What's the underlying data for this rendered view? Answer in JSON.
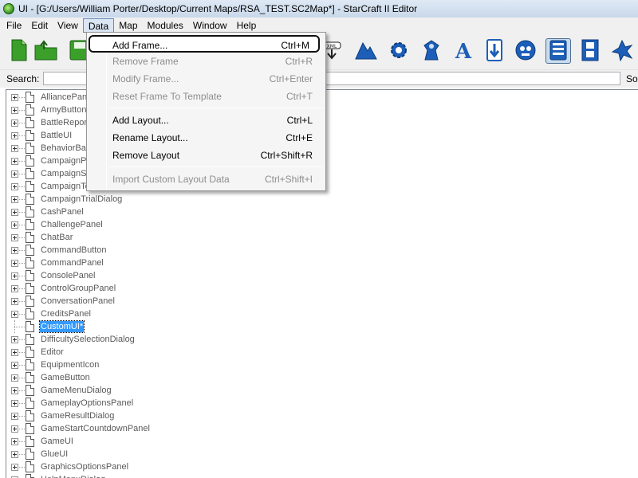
{
  "window": {
    "title": "UI - [G:/Users/William Porter/Desktop/Current Maps/RSA_TEST.SC2Map*] - StarCraft II Editor"
  },
  "menubar": {
    "items": [
      "File",
      "Edit",
      "View",
      "Data",
      "Map",
      "Modules",
      "Window",
      "Help"
    ],
    "active": "Data"
  },
  "toolbar": {
    "buttons": [
      {
        "icon": "new-file-icon",
        "color": "#3aa02a"
      },
      {
        "icon": "open-folder-icon",
        "color": "#3aa02a"
      },
      {
        "icon": "save-icon",
        "color": "#3aa02a"
      },
      {
        "icon": "import-xml-icon",
        "color": "#222222"
      },
      {
        "icon": "terrain-icon",
        "color": "#1d5fb8"
      },
      {
        "icon": "triggers-gear-icon",
        "color": "#1d5fb8"
      },
      {
        "icon": "data-unit-icon",
        "color": "#1d5fb8"
      },
      {
        "icon": "text-icon",
        "color": "#1d5fb8"
      },
      {
        "icon": "import-arrow-icon",
        "color": "#1d5fb8"
      },
      {
        "icon": "cinematics-face-icon",
        "color": "#1d5fb8"
      },
      {
        "icon": "ui-editor-icon",
        "color": "#1d5fb8",
        "pressed": true
      },
      {
        "icon": "film-icon",
        "color": "#1d5fb8"
      },
      {
        "icon": "ai-icon",
        "color": "#1d5fb8"
      }
    ]
  },
  "search": {
    "label": "Search:",
    "value": "",
    "sort_label": "Sort"
  },
  "data_menu": {
    "items": [
      {
        "label": "Add Frame...",
        "shortcut": "Ctrl+M",
        "enabled": true,
        "highlighted": true
      },
      {
        "label": "Remove Frame",
        "shortcut": "Ctrl+R",
        "enabled": false
      },
      {
        "label": "Modify Frame...",
        "shortcut": "Ctrl+Enter",
        "enabled": false
      },
      {
        "label": "Reset Frame To Template",
        "shortcut": "Ctrl+T",
        "enabled": false
      },
      {
        "separator": true
      },
      {
        "label": "Add Layout...",
        "shortcut": "Ctrl+L",
        "enabled": true
      },
      {
        "label": "Rename Layout...",
        "shortcut": "Ctrl+E",
        "enabled": true
      },
      {
        "label": "Remove Layout",
        "shortcut": "Ctrl+Shift+R",
        "enabled": true
      },
      {
        "separator": true
      },
      {
        "label": "Import Custom Layout Data",
        "shortcut": "Ctrl+Shift+I",
        "enabled": false
      }
    ]
  },
  "tree": {
    "items": [
      {
        "label": "AlliancePanel"
      },
      {
        "label": "ArmyButton"
      },
      {
        "label": "BattleReportPanel"
      },
      {
        "label": "BattleUI"
      },
      {
        "label": "BehaviorBar"
      },
      {
        "label": "CampaignPanel"
      },
      {
        "label": "CampaignScreen"
      },
      {
        "label": "CampaignTechPanel"
      },
      {
        "label": "CampaignTrialDialog"
      },
      {
        "label": "CashPanel"
      },
      {
        "label": "ChallengePanel"
      },
      {
        "label": "ChatBar"
      },
      {
        "label": "CommandButton"
      },
      {
        "label": "CommandPanel"
      },
      {
        "label": "ConsolePanel"
      },
      {
        "label": "ControlGroupPanel"
      },
      {
        "label": "ConversationPanel"
      },
      {
        "label": "CreditsPanel"
      },
      {
        "label": "CustomUI*",
        "selected": true,
        "leaf": true
      },
      {
        "label": "DifficultySelectionDialog"
      },
      {
        "label": "Editor"
      },
      {
        "label": "EquipmentIcon"
      },
      {
        "label": "GameButton"
      },
      {
        "label": "GameMenuDialog"
      },
      {
        "label": "GameplayOptionsPanel"
      },
      {
        "label": "GameResultDialog"
      },
      {
        "label": "GameStartCountdownPanel"
      },
      {
        "label": "GameUI"
      },
      {
        "label": "GlueUI"
      },
      {
        "label": "GraphicsOptionsPanel"
      },
      {
        "label": "HelpMenuDialog"
      }
    ]
  }
}
